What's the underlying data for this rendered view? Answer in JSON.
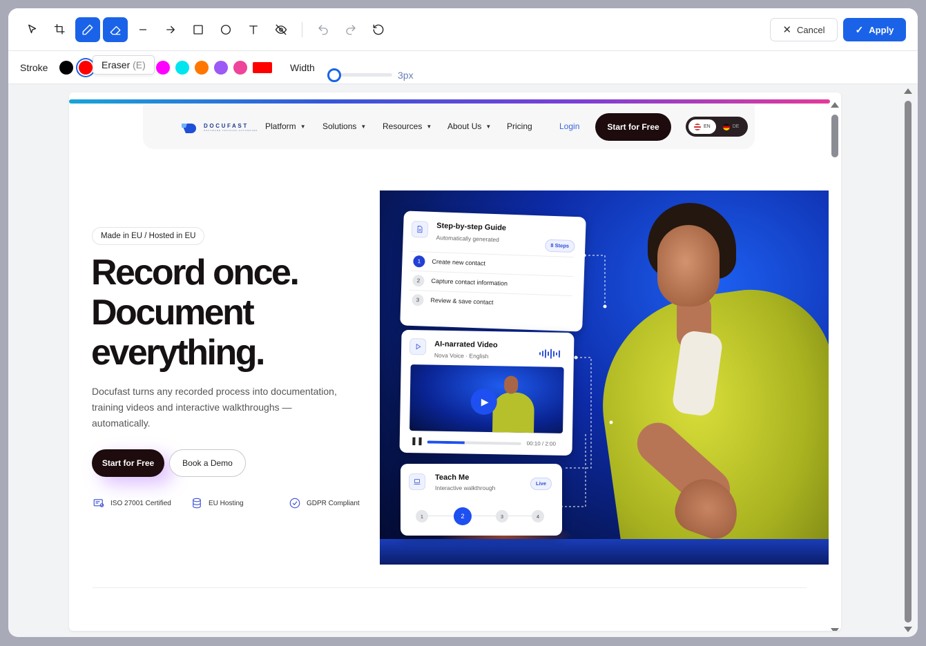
{
  "toolbar": {
    "tools": [
      {
        "name": "select",
        "icon": "cursor-icon",
        "active": false
      },
      {
        "name": "crop",
        "icon": "crop-icon",
        "active": false
      },
      {
        "name": "pen",
        "icon": "pen-icon",
        "active": true
      },
      {
        "name": "eraser",
        "icon": "eraser-icon",
        "active": true
      },
      {
        "name": "line",
        "icon": "line-icon",
        "active": false
      },
      {
        "name": "arrow",
        "icon": "arrow-icon",
        "active": false
      },
      {
        "name": "rectangle",
        "icon": "rectangle-icon",
        "active": false
      },
      {
        "name": "ellipse",
        "icon": "ellipse-icon",
        "active": false
      },
      {
        "name": "text",
        "icon": "text-icon",
        "active": false
      },
      {
        "name": "blur",
        "icon": "eye-off-icon",
        "active": false
      }
    ],
    "history": [
      {
        "name": "undo",
        "icon": "undo-icon"
      },
      {
        "name": "redo",
        "icon": "redo-icon"
      },
      {
        "name": "reset",
        "icon": "reset-icon"
      }
    ],
    "cancel_label": "Cancel",
    "apply_label": "Apply"
  },
  "tooltip": {
    "label": "Eraser",
    "shortcut": "(E)"
  },
  "options": {
    "stroke_label": "Stroke",
    "colors": [
      "#000000",
      "#ff0000",
      "#22dd22",
      "#0000ee",
      "#ffee00",
      "#ff00ff",
      "#00e5ee",
      "#ff7700",
      "#9b59f6",
      "#ee4499"
    ],
    "selected_color": "#ff0000",
    "fill_swatch": "#ff0000",
    "width_label": "Width",
    "width_value": "3px"
  },
  "page": {
    "nav": {
      "logo_text": "DOCUFAST",
      "logo_sub": "SOFTWARE TRAINING AUTOMATED",
      "items": [
        "Platform",
        "Solutions",
        "Resources",
        "About Us",
        "Pricing"
      ],
      "login": "Login",
      "cta": "Start for Free",
      "lang_on": "EN",
      "lang_off": "DE"
    },
    "hero": {
      "badge": "Made in EU / Hosted in EU",
      "headline_1": "Record once.",
      "headline_2": "Document",
      "headline_3": "everything.",
      "sub_1": "Docufast turns any recorded process into documentation,",
      "sub_2": "training videos and interactive walkthroughs —",
      "sub_3": "automatically.",
      "cta_primary": "Start for Free",
      "cta_secondary": "Book a Demo",
      "trust": [
        "ISO 27001 Certified",
        "EU Hosting",
        "GDPR Compliant"
      ]
    },
    "cards": {
      "guide": {
        "title": "Step-by-step Guide",
        "sub": "Automatically generated",
        "chip": "8 Steps",
        "steps": [
          {
            "num": "1",
            "label": "Create new contact"
          },
          {
            "num": "2",
            "label": "Capture contact information"
          },
          {
            "num": "3",
            "label": "Review & save contact"
          }
        ]
      },
      "video": {
        "title": "AI-narrated Video",
        "sub": "Nova Voice · English",
        "time": "00:10 / 2:00",
        "progress": 0.4
      },
      "teach": {
        "title": "Teach Me",
        "sub": "Interactive walkthrough",
        "chip": "Live",
        "steps": [
          "1",
          "2",
          "3",
          "4"
        ],
        "current": "2"
      }
    }
  }
}
